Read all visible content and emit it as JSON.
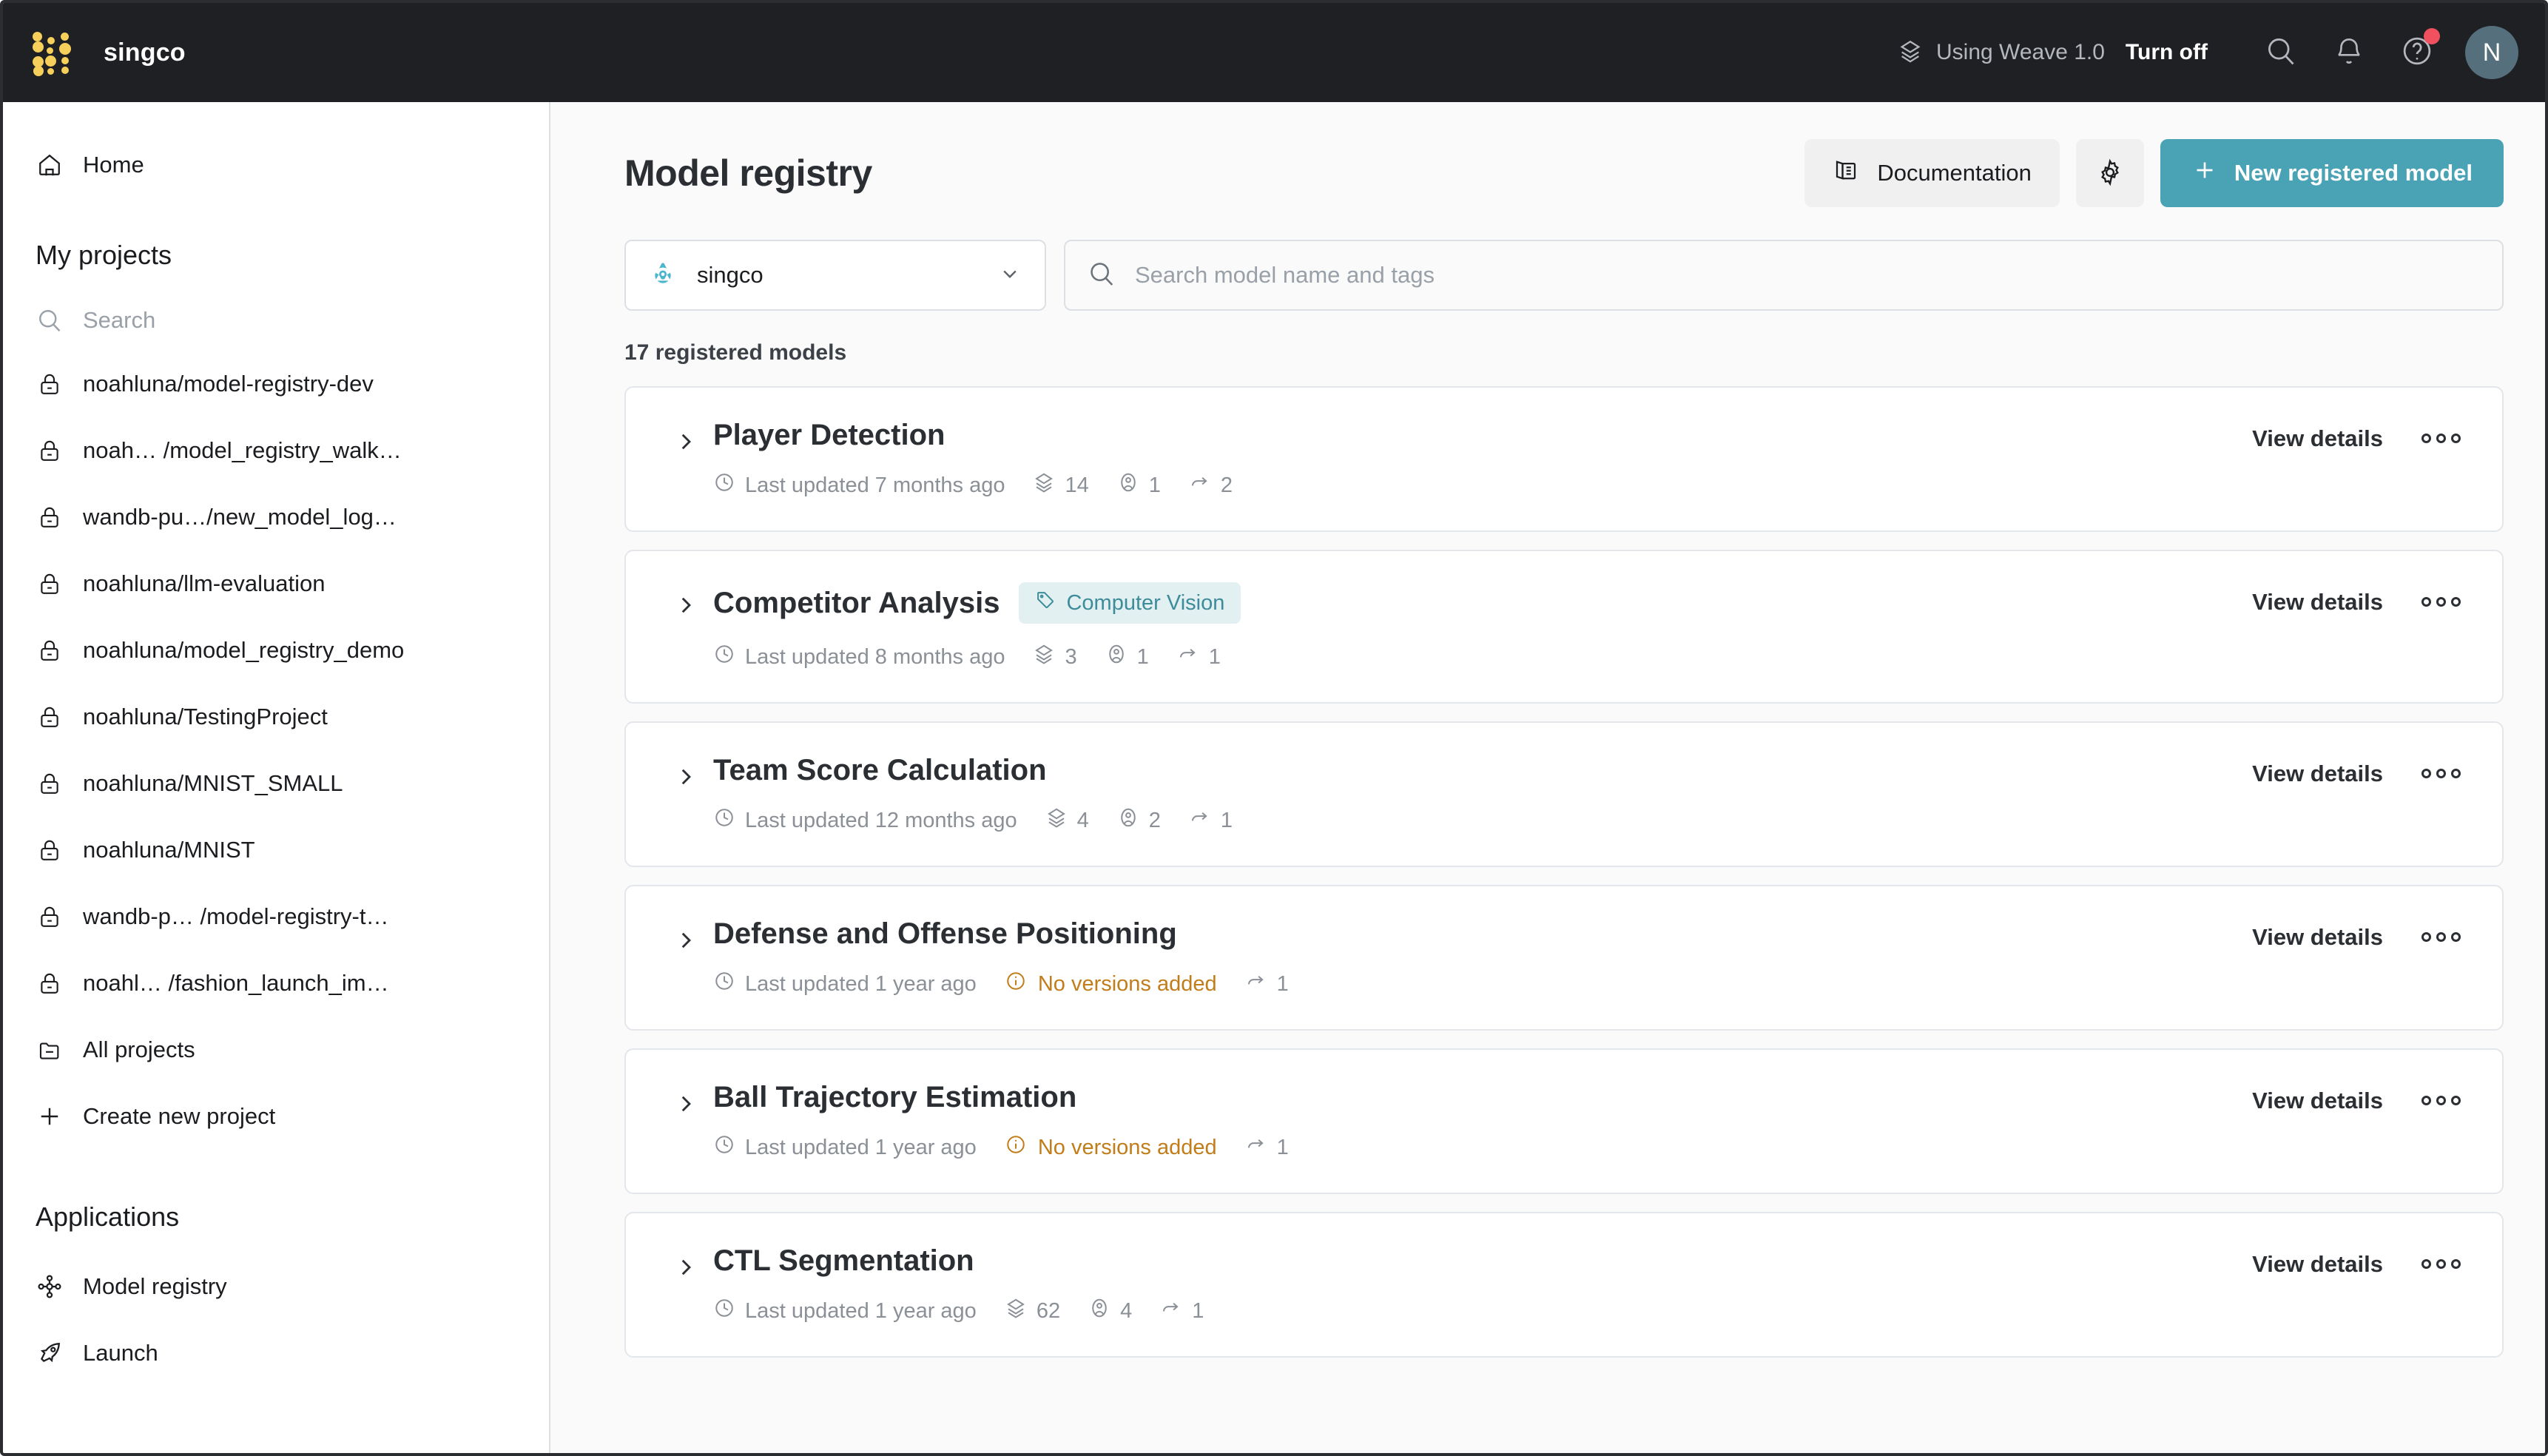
{
  "topbar": {
    "org_name": "singco",
    "logo_icon": "wandb-dots-logo",
    "weave_label": "Using Weave 1.0",
    "weave_toggle_label": "Turn off",
    "weave_icon": "layers-icon",
    "search_icon": "search-icon",
    "notifications_icon": "bell-icon",
    "help_icon": "help-circle-icon",
    "help_badge": true,
    "avatar_initial": "N",
    "avatar_color": "#55707c",
    "badge_color": "#f1515f"
  },
  "sidebar": {
    "home": {
      "label": "Home",
      "icon": "home-icon"
    },
    "projects_heading": "My projects",
    "search_placeholder": "Search",
    "search_icon": "search-icon",
    "projects": [
      {
        "label": "noahluna/model-registry-dev",
        "icon": "lock-icon"
      },
      {
        "label": "noah… /model_registry_walk…",
        "icon": "lock-icon"
      },
      {
        "label": "wandb-pu…/new_model_log…",
        "icon": "lock-icon"
      },
      {
        "label": "noahluna/llm-evaluation",
        "icon": "lock-icon"
      },
      {
        "label": "noahluna/model_registry_demo",
        "icon": "lock-icon"
      },
      {
        "label": "noahluna/TestingProject",
        "icon": "lock-icon"
      },
      {
        "label": "noahluna/MNIST_SMALL",
        "icon": "lock-icon"
      },
      {
        "label": "noahluna/MNIST",
        "icon": "lock-icon"
      },
      {
        "label": "wandb-p… /model-registry-t…",
        "icon": "lock-icon"
      },
      {
        "label": "noahl… /fashion_launch_im…",
        "icon": "lock-icon"
      }
    ],
    "all_projects": {
      "label": "All projects",
      "icon": "folder-icon"
    },
    "create_project": {
      "label": "Create new project",
      "icon": "plus-icon"
    },
    "applications_heading": "Applications",
    "applications": [
      {
        "label": "Model registry",
        "icon": "model-registry-icon"
      },
      {
        "label": "Launch",
        "icon": "rocket-icon"
      }
    ]
  },
  "main": {
    "page_title": "Model registry",
    "documentation_label": "Documentation",
    "documentation_icon": "book-icon",
    "settings_icon": "gear-icon",
    "new_model_label": "New registered model",
    "new_model_icon": "plus-icon",
    "accent_color": "#4aa2b5",
    "org_select": {
      "value": "singco",
      "icon": "team-icon",
      "chevron": "chevron-down-icon"
    },
    "search": {
      "value": "",
      "placeholder": "Search model name and tags",
      "icon": "search-icon"
    },
    "count_text": "17 registered models",
    "view_details_label": "View details",
    "more_icon": "more-horizontal-icon",
    "expand_icon": "chevron-right-icon",
    "clock_icon": "clock-icon",
    "versions_icon": "layers-icon",
    "users_icon": "user-circle-icon",
    "links_icon": "arrow-link-icon",
    "warn_icon": "info-circle-icon",
    "warn_color": "#c17d19",
    "models": [
      {
        "name": "Player Detection",
        "tag": null,
        "updated": "Last updated 7 months ago",
        "versions": "14",
        "users": "1",
        "links": "2",
        "warning": null
      },
      {
        "name": "Competitor Analysis",
        "tag": "Computer Vision",
        "updated": "Last updated 8 months ago",
        "versions": "3",
        "users": "1",
        "links": "1",
        "warning": null
      },
      {
        "name": "Team Score Calculation",
        "tag": null,
        "updated": "Last updated 12 months ago",
        "versions": "4",
        "users": "2",
        "links": "1",
        "warning": null
      },
      {
        "name": "Defense and Offense Positioning",
        "tag": null,
        "updated": "Last updated 1 year ago",
        "versions": null,
        "users": null,
        "links": "1",
        "warning": "No versions added"
      },
      {
        "name": "Ball Trajectory Estimation",
        "tag": null,
        "updated": "Last updated 1 year ago",
        "versions": null,
        "users": null,
        "links": "1",
        "warning": "No versions added"
      },
      {
        "name": "CTL Segmentation",
        "tag": null,
        "updated": "Last updated 1 year ago",
        "versions": "62",
        "users": "4",
        "links": "1",
        "warning": null
      }
    ]
  }
}
